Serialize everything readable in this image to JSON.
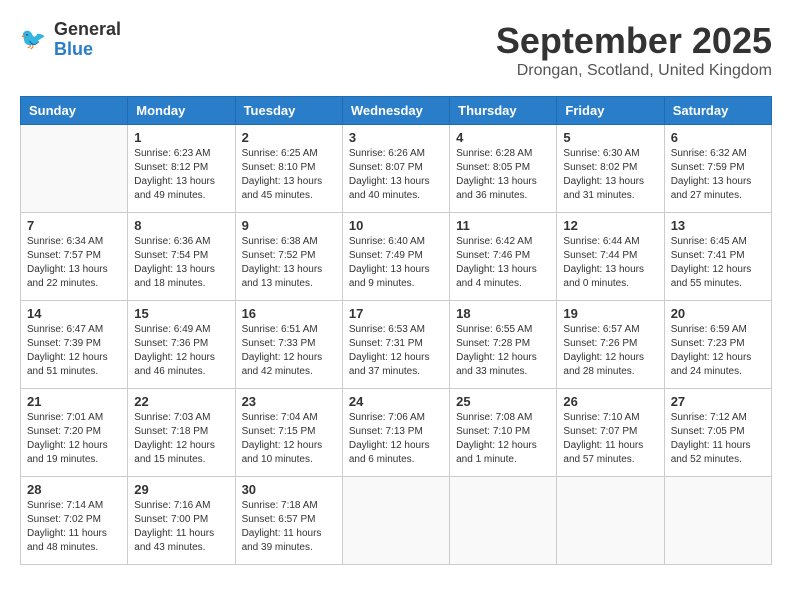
{
  "header": {
    "logo_line1": "General",
    "logo_line2": "Blue",
    "title": "September 2025",
    "subtitle": "Drongan, Scotland, United Kingdom"
  },
  "days_of_week": [
    "Sunday",
    "Monday",
    "Tuesday",
    "Wednesday",
    "Thursday",
    "Friday",
    "Saturday"
  ],
  "weeks": [
    [
      {
        "day": "",
        "sunrise": "",
        "sunset": "",
        "daylight": ""
      },
      {
        "day": "1",
        "sunrise": "Sunrise: 6:23 AM",
        "sunset": "Sunset: 8:12 PM",
        "daylight": "Daylight: 13 hours and 49 minutes."
      },
      {
        "day": "2",
        "sunrise": "Sunrise: 6:25 AM",
        "sunset": "Sunset: 8:10 PM",
        "daylight": "Daylight: 13 hours and 45 minutes."
      },
      {
        "day": "3",
        "sunrise": "Sunrise: 6:26 AM",
        "sunset": "Sunset: 8:07 PM",
        "daylight": "Daylight: 13 hours and 40 minutes."
      },
      {
        "day": "4",
        "sunrise": "Sunrise: 6:28 AM",
        "sunset": "Sunset: 8:05 PM",
        "daylight": "Daylight: 13 hours and 36 minutes."
      },
      {
        "day": "5",
        "sunrise": "Sunrise: 6:30 AM",
        "sunset": "Sunset: 8:02 PM",
        "daylight": "Daylight: 13 hours and 31 minutes."
      },
      {
        "day": "6",
        "sunrise": "Sunrise: 6:32 AM",
        "sunset": "Sunset: 7:59 PM",
        "daylight": "Daylight: 13 hours and 27 minutes."
      }
    ],
    [
      {
        "day": "7",
        "sunrise": "Sunrise: 6:34 AM",
        "sunset": "Sunset: 7:57 PM",
        "daylight": "Daylight: 13 hours and 22 minutes."
      },
      {
        "day": "8",
        "sunrise": "Sunrise: 6:36 AM",
        "sunset": "Sunset: 7:54 PM",
        "daylight": "Daylight: 13 hours and 18 minutes."
      },
      {
        "day": "9",
        "sunrise": "Sunrise: 6:38 AM",
        "sunset": "Sunset: 7:52 PM",
        "daylight": "Daylight: 13 hours and 13 minutes."
      },
      {
        "day": "10",
        "sunrise": "Sunrise: 6:40 AM",
        "sunset": "Sunset: 7:49 PM",
        "daylight": "Daylight: 13 hours and 9 minutes."
      },
      {
        "day": "11",
        "sunrise": "Sunrise: 6:42 AM",
        "sunset": "Sunset: 7:46 PM",
        "daylight": "Daylight: 13 hours and 4 minutes."
      },
      {
        "day": "12",
        "sunrise": "Sunrise: 6:44 AM",
        "sunset": "Sunset: 7:44 PM",
        "daylight": "Daylight: 13 hours and 0 minutes."
      },
      {
        "day": "13",
        "sunrise": "Sunrise: 6:45 AM",
        "sunset": "Sunset: 7:41 PM",
        "daylight": "Daylight: 12 hours and 55 minutes."
      }
    ],
    [
      {
        "day": "14",
        "sunrise": "Sunrise: 6:47 AM",
        "sunset": "Sunset: 7:39 PM",
        "daylight": "Daylight: 12 hours and 51 minutes."
      },
      {
        "day": "15",
        "sunrise": "Sunrise: 6:49 AM",
        "sunset": "Sunset: 7:36 PM",
        "daylight": "Daylight: 12 hours and 46 minutes."
      },
      {
        "day": "16",
        "sunrise": "Sunrise: 6:51 AM",
        "sunset": "Sunset: 7:33 PM",
        "daylight": "Daylight: 12 hours and 42 minutes."
      },
      {
        "day": "17",
        "sunrise": "Sunrise: 6:53 AM",
        "sunset": "Sunset: 7:31 PM",
        "daylight": "Daylight: 12 hours and 37 minutes."
      },
      {
        "day": "18",
        "sunrise": "Sunrise: 6:55 AM",
        "sunset": "Sunset: 7:28 PM",
        "daylight": "Daylight: 12 hours and 33 minutes."
      },
      {
        "day": "19",
        "sunrise": "Sunrise: 6:57 AM",
        "sunset": "Sunset: 7:26 PM",
        "daylight": "Daylight: 12 hours and 28 minutes."
      },
      {
        "day": "20",
        "sunrise": "Sunrise: 6:59 AM",
        "sunset": "Sunset: 7:23 PM",
        "daylight": "Daylight: 12 hours and 24 minutes."
      }
    ],
    [
      {
        "day": "21",
        "sunrise": "Sunrise: 7:01 AM",
        "sunset": "Sunset: 7:20 PM",
        "daylight": "Daylight: 12 hours and 19 minutes."
      },
      {
        "day": "22",
        "sunrise": "Sunrise: 7:03 AM",
        "sunset": "Sunset: 7:18 PM",
        "daylight": "Daylight: 12 hours and 15 minutes."
      },
      {
        "day": "23",
        "sunrise": "Sunrise: 7:04 AM",
        "sunset": "Sunset: 7:15 PM",
        "daylight": "Daylight: 12 hours and 10 minutes."
      },
      {
        "day": "24",
        "sunrise": "Sunrise: 7:06 AM",
        "sunset": "Sunset: 7:13 PM",
        "daylight": "Daylight: 12 hours and 6 minutes."
      },
      {
        "day": "25",
        "sunrise": "Sunrise: 7:08 AM",
        "sunset": "Sunset: 7:10 PM",
        "daylight": "Daylight: 12 hours and 1 minute."
      },
      {
        "day": "26",
        "sunrise": "Sunrise: 7:10 AM",
        "sunset": "Sunset: 7:07 PM",
        "daylight": "Daylight: 11 hours and 57 minutes."
      },
      {
        "day": "27",
        "sunrise": "Sunrise: 7:12 AM",
        "sunset": "Sunset: 7:05 PM",
        "daylight": "Daylight: 11 hours and 52 minutes."
      }
    ],
    [
      {
        "day": "28",
        "sunrise": "Sunrise: 7:14 AM",
        "sunset": "Sunset: 7:02 PM",
        "daylight": "Daylight: 11 hours and 48 minutes."
      },
      {
        "day": "29",
        "sunrise": "Sunrise: 7:16 AM",
        "sunset": "Sunset: 7:00 PM",
        "daylight": "Daylight: 11 hours and 43 minutes."
      },
      {
        "day": "30",
        "sunrise": "Sunrise: 7:18 AM",
        "sunset": "Sunset: 6:57 PM",
        "daylight": "Daylight: 11 hours and 39 minutes."
      },
      {
        "day": "",
        "sunrise": "",
        "sunset": "",
        "daylight": ""
      },
      {
        "day": "",
        "sunrise": "",
        "sunset": "",
        "daylight": ""
      },
      {
        "day": "",
        "sunrise": "",
        "sunset": "",
        "daylight": ""
      },
      {
        "day": "",
        "sunrise": "",
        "sunset": "",
        "daylight": ""
      }
    ]
  ]
}
